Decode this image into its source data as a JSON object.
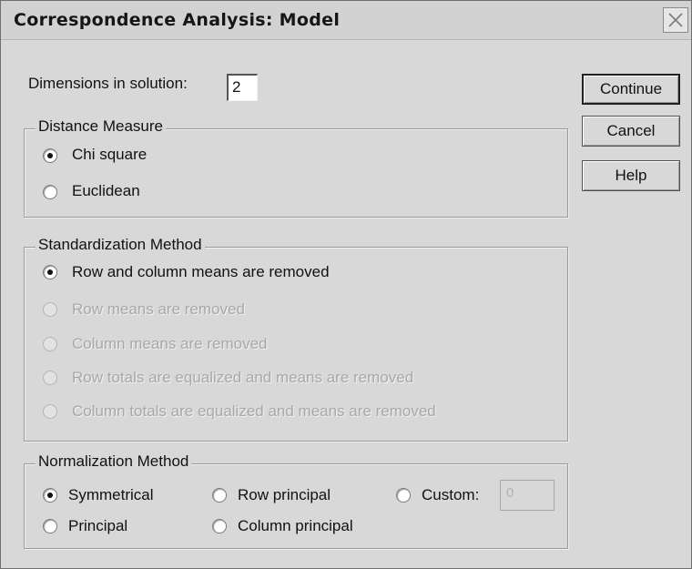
{
  "window": {
    "title": "Correspondence Analysis: Model",
    "close_icon": "close-icon"
  },
  "dimensions": {
    "label": "Dimensions in solution:",
    "value": "2"
  },
  "distance_measure": {
    "title": "Distance Measure",
    "options": [
      {
        "label": "Chi square",
        "checked": true,
        "enabled": true
      },
      {
        "label": "Euclidean",
        "checked": false,
        "enabled": true
      }
    ]
  },
  "standardization": {
    "title": "Standardization Method",
    "options": [
      {
        "label": "Row and column means are removed",
        "checked": true,
        "enabled": true
      },
      {
        "label": "Row means are removed",
        "checked": false,
        "enabled": false
      },
      {
        "label": "Column means are removed",
        "checked": false,
        "enabled": false
      },
      {
        "label": "Row totals are equalized and means are removed",
        "checked": false,
        "enabled": false
      },
      {
        "label": "Column totals are equalized and means are removed",
        "checked": false,
        "enabled": false
      }
    ]
  },
  "normalization": {
    "title": "Normalization Method",
    "options": [
      {
        "label": "Symmetrical",
        "checked": true,
        "enabled": true
      },
      {
        "label": "Row principal",
        "checked": false,
        "enabled": true
      },
      {
        "label": "Custom:",
        "checked": false,
        "enabled": true
      },
      {
        "label": "Principal",
        "checked": false,
        "enabled": true
      },
      {
        "label": "Column principal",
        "checked": false,
        "enabled": true
      }
    ],
    "custom_value": "0"
  },
  "buttons": {
    "continue": "Continue",
    "cancel": "Cancel",
    "help": "Help"
  }
}
